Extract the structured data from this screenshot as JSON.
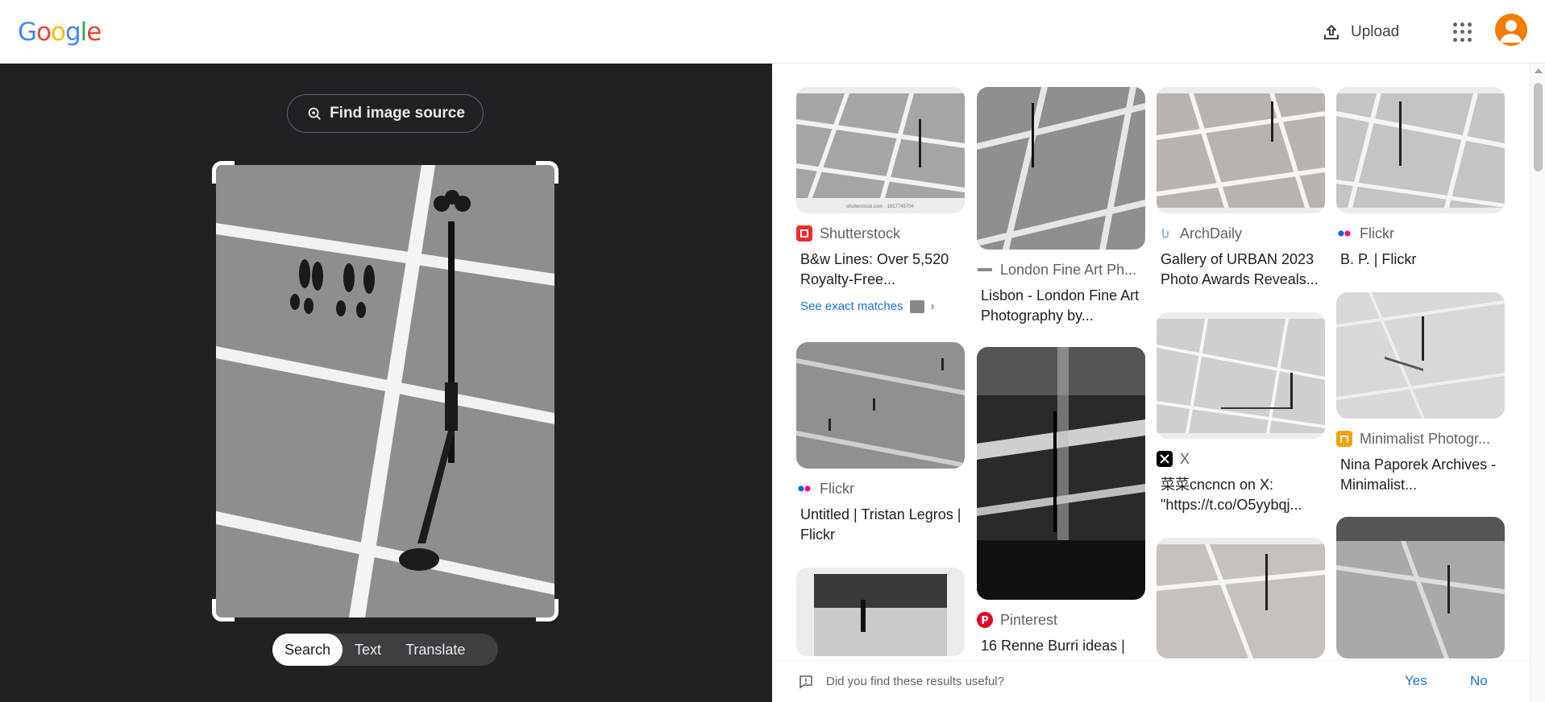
{
  "header": {
    "logo": "Google",
    "upload_label": "Upload",
    "apps_icon": "apps-grid-icon",
    "avatar_icon": "account-avatar-icon"
  },
  "lens": {
    "find_source_label": "Find image source",
    "modes": [
      "Search",
      "Text",
      "Translate"
    ],
    "active_mode": "Search"
  },
  "results": [
    {
      "source": "Shutterstock",
      "title": "B&w Lines: Over 5,520 Royalty-Free...",
      "see_exact": "See exact matches",
      "caption": "shutterstock.com · 1817745704"
    },
    {
      "source": "Flickr",
      "title": "Untitled | Tristan Legros | Flickr"
    },
    {
      "source": "London Fine Art Ph...",
      "title": "Lisbon - London Fine Art Photography by..."
    },
    {
      "source": "Pinterest",
      "title": "16 Renne Burri ideas |"
    },
    {
      "source": "ArchDaily",
      "title": "Gallery of URBAN 2023 Photo Awards Reveals..."
    },
    {
      "source": "X",
      "title": "菜菜cncncn on X: \"https://t.co/O5yybqj..."
    },
    {
      "source": "Flickr",
      "title": "B. P. | Flickr"
    },
    {
      "source": "Minimalist Photogr...",
      "title": "Nina Paporek Archives - Minimalist..."
    }
  ],
  "feedback": {
    "question": "Did you find these results useful?",
    "yes": "Yes",
    "no": "No"
  },
  "colors": {
    "dark_panel": "#202124",
    "link_blue": "#1a73e8",
    "avatar": "#f57c00"
  }
}
